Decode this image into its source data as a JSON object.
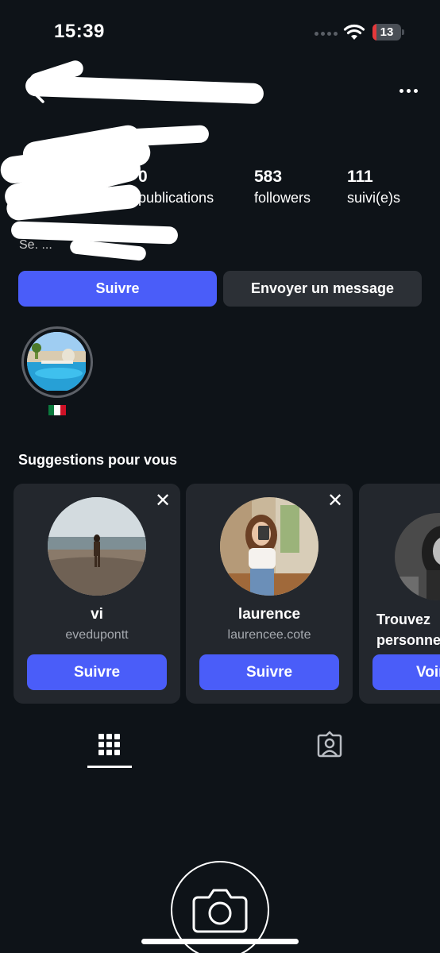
{
  "status_bar": {
    "time": "15:39",
    "battery_level": "13",
    "battery_color": "#e5383b"
  },
  "header": {
    "back_icon": "chevron-left-icon",
    "more_icon": "more-horizontal-icon"
  },
  "profile": {
    "stats": {
      "posts_value": "0",
      "posts_label": "publications",
      "followers_value": "583",
      "followers_label": "followers",
      "following_value": "111",
      "following_label": "suivi(e)s"
    },
    "bio_visible_fragment": "Se. ..."
  },
  "actions": {
    "follow_label": "Suivre",
    "message_label": "Envoyer un message"
  },
  "highlights": [
    {
      "label_icon": "mexico-flag-icon"
    }
  ],
  "suggestions": {
    "title": "Suggestions pour vous",
    "cards": [
      {
        "name": "vi",
        "username": "evedupontt",
        "button": "Suivre"
      },
      {
        "name": "laurence",
        "username": "laurencee.cote",
        "button": "Suivre"
      },
      {
        "name": "Trouvez",
        "name_line2": "personne",
        "button": "Voir"
      }
    ]
  },
  "tabs": [
    {
      "icon": "grid-icon",
      "active": true
    },
    {
      "icon": "tagged-person-icon",
      "active": false
    }
  ],
  "colors": {
    "background": "#0e1318",
    "accent": "#4a5df9",
    "secondary_button": "#2c3036",
    "card": "#23272d"
  }
}
